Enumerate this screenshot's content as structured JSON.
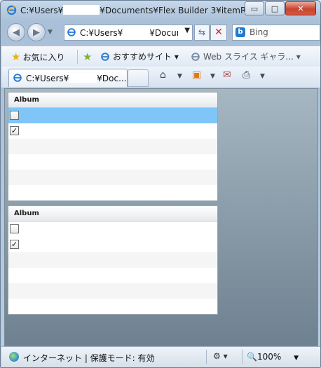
{
  "window": {
    "title_prefix": "C:¥Users¥",
    "title_suffix": "¥Documents¥Flex Builder 3¥itemR...",
    "minimize": "▭",
    "maximize": "□",
    "close": "✕"
  },
  "address_bar": {
    "prefix": "C:¥Users¥",
    "suffix": "¥Docum",
    "search_placeholder": "Bing"
  },
  "favorites_bar": {
    "favorites_label": "お気に入り",
    "suggested_sites": "おすすめサイト ▾",
    "web_slice_gallery": "Web スライス ギャラ... ▾",
    "overflow": "»"
  },
  "tab": {
    "prefix": "C:¥Users¥",
    "suffix": "¥Doc..."
  },
  "grids": [
    {
      "header": "Album",
      "rows": [
        {
          "checked": false,
          "selected": true
        },
        {
          "checked": true,
          "selected": false
        },
        {
          "checked": null,
          "selected": false
        },
        {
          "checked": null,
          "selected": false
        },
        {
          "checked": null,
          "selected": false
        },
        {
          "checked": null,
          "selected": false
        }
      ]
    },
    {
      "header": "Album",
      "rows": [
        {
          "checked": false,
          "selected": false
        },
        {
          "checked": true,
          "selected": false
        },
        {
          "checked": null,
          "selected": false
        },
        {
          "checked": null,
          "selected": false
        },
        {
          "checked": null,
          "selected": false
        },
        {
          "checked": null,
          "selected": false
        }
      ]
    }
  ],
  "status_bar": {
    "zone": "インターネット | 保護モード: 有効",
    "zoom": "100%"
  },
  "colors": {
    "selection": "#7fc5f7",
    "alt_row": "#f5f5f5"
  }
}
